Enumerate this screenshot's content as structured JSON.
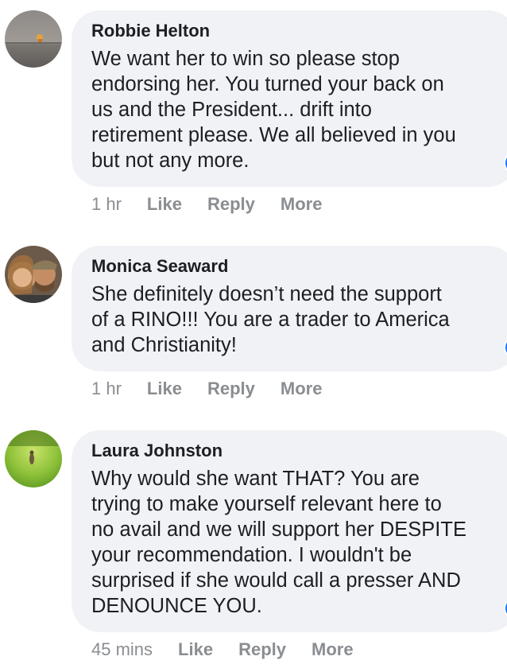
{
  "comments": [
    {
      "author": "Robbie Helton",
      "text": "We want her to win so please stop\nendorsing her. You turned your back on\nus and the President... drift into\nretirement please. We all believed in you\nbut not any more.",
      "time": "1 hr",
      "like_label": "Like",
      "reply_label": "Reply",
      "more_label": "More",
      "avatar_icon": "sunset-lake-photo"
    },
    {
      "author": "Monica Seaward",
      "text": "She definitely doesn’t need the support\nof a RINO!!! You are a trader to America\nand Christianity!",
      "time": "1 hr",
      "like_label": "Like",
      "reply_label": "Reply",
      "more_label": "More",
      "avatar_icon": "couple-selfie-photo"
    },
    {
      "author": "Laura Johnston",
      "text": "Why would she want THAT? You are\ntrying to make yourself relevant here to\nno avail and we will support her DESPITE\nyour recommendation. I wouldn't be\nsurprised if she would call a presser AND\nDENOUNCE YOU.",
      "time": "45 mins",
      "like_label": "Like",
      "reply_label": "Reply",
      "more_label": "More",
      "avatar_icon": "green-field-photo"
    }
  ],
  "colors": {
    "bubble": "#f0f2f5",
    "text": "#1c1e21",
    "meta": "#8a8d91",
    "reaction": "#1877f2"
  }
}
